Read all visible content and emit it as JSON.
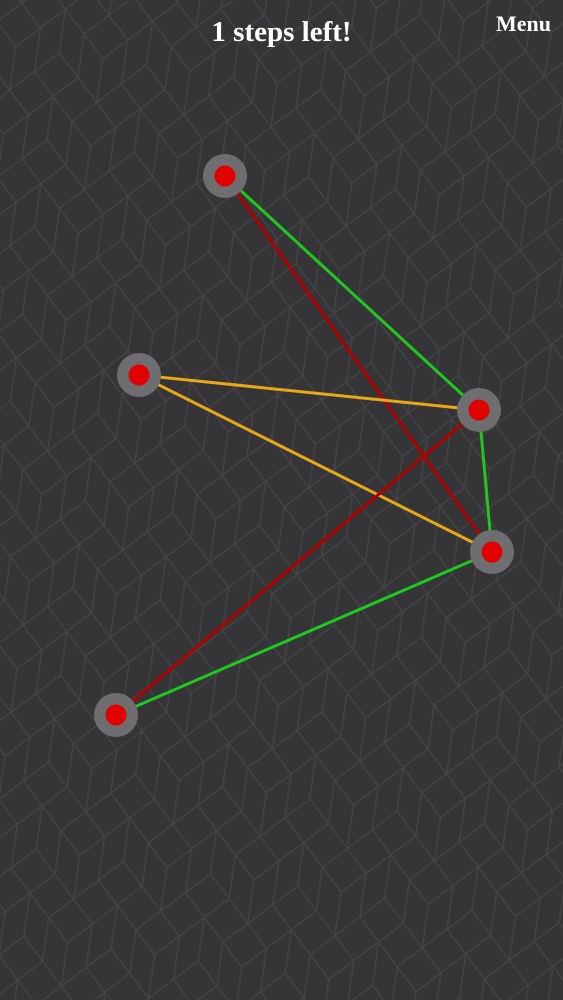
{
  "header": {
    "status_text": "1 steps left!",
    "menu_label": "Menu"
  },
  "colors": {
    "background": "#353436",
    "pattern_line": "#444346",
    "node_ring": "#6e6d70",
    "node_core": "#e00000",
    "edge_green": "#1ec81e",
    "edge_red": "#b00000",
    "edge_orange": "#e8a817"
  },
  "puzzle": {
    "nodes": [
      {
        "id": "n1"
      },
      {
        "id": "n2"
      },
      {
        "id": "n3"
      },
      {
        "id": "n4"
      },
      {
        "id": "n5"
      }
    ],
    "edges": [
      {
        "from": "n1",
        "to": "n3",
        "state": "green"
      },
      {
        "from": "n1",
        "to": "n4",
        "state": "red"
      },
      {
        "from": "n2",
        "to": "n3",
        "state": "orange"
      },
      {
        "from": "n2",
        "to": "n4",
        "state": "orange"
      },
      {
        "from": "n3",
        "to": "n4",
        "state": "green"
      },
      {
        "from": "n3",
        "to": "n5",
        "state": "red"
      },
      {
        "from": "n4",
        "to": "n5",
        "state": "green"
      }
    ]
  }
}
